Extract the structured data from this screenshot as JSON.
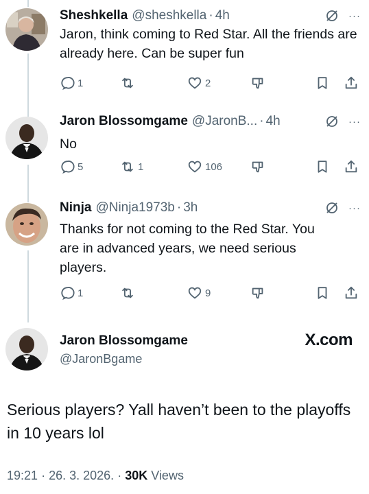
{
  "replies": [
    {
      "name": "Sheshkella",
      "handle": "@sheshkella",
      "time": "4h",
      "text": "Jaron, think coming to Red Star. All the friends are already here. Can be super fun",
      "stats": {
        "replies": "1",
        "reposts": "",
        "likes": "2"
      }
    },
    {
      "name": "Jaron Blossomgame",
      "handle": "@JaronB...",
      "time": "4h",
      "text": "No",
      "stats": {
        "replies": "5",
        "reposts": "1",
        "likes": "106"
      }
    },
    {
      "name": "Ninja",
      "handle": "@Ninja1973b",
      "time": "3h",
      "text": "Thanks for not coming to the Red Star. You are in advanced years, we need serious players.",
      "stats": {
        "replies": "1",
        "reposts": "",
        "likes": "9"
      }
    }
  ],
  "main": {
    "name": "Jaron Blossomgame",
    "handle": "@JaronBgame",
    "brand": "X.com",
    "text": "Serious players? Yall haven’t been to the playoffs in 10 years lol",
    "time": "19:21",
    "date": "26. 3. 2026.",
    "views_count": "30K",
    "views_label": "Views"
  },
  "separator": "·",
  "more_label": "···",
  "icons": [
    "grok-icon",
    "more-icon",
    "reply-icon",
    "repost-icon",
    "like-icon",
    "dislike-icon",
    "bookmark-icon",
    "share-icon"
  ],
  "colors": {
    "text": "#0f1419",
    "secondary": "#536471",
    "thread_line": "#cfd9de"
  }
}
